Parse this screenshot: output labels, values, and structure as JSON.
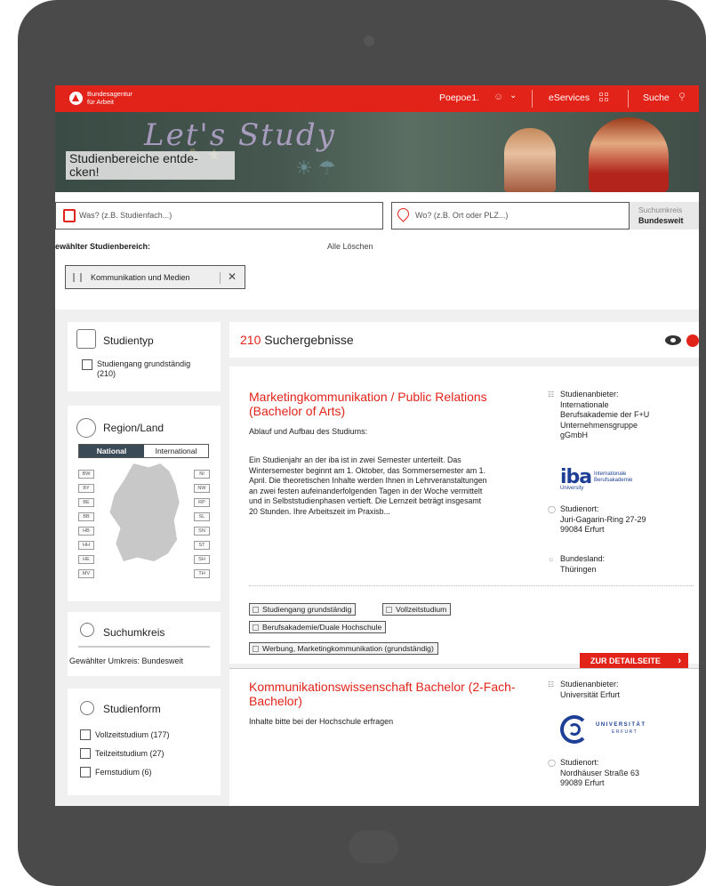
{
  "header": {
    "brand_line1": "Bundesagentur",
    "brand_line2": "für Arbeit",
    "user_name": "Poepoe1.",
    "eservices_label": "eServices",
    "search_label": "Suche"
  },
  "hero": {
    "title_line1": "Studienbereiche entde-",
    "title_line2": "cken!",
    "chalk_text": "Let's Study"
  },
  "search": {
    "what_placeholder": "Was? (z.B. Studienfach...)",
    "where_placeholder": "Wo? (z.B. Ort oder PLZ...)",
    "radius_label": "Suchumkreis",
    "radius_value": "Bundesweit",
    "chosen_label": "ewählter Studienbereich:",
    "clear_all_label": "Alle Löschen",
    "chip_label": "Kommunikation und Medien"
  },
  "filters": {
    "studientyp": {
      "title": "Studientyp",
      "option_line1": "Studiengang grundständig",
      "option_line2": "(210)"
    },
    "region": {
      "title": "Region/Land",
      "toggle_national": "National",
      "toggle_international": "International",
      "states_left": [
        "BW",
        "BY",
        "BE",
        "BB",
        "HB",
        "HH",
        "HE",
        "MV"
      ],
      "states_right": [
        "NI",
        "NW",
        "RP",
        "SL",
        "SN",
        "ST",
        "SH",
        "TH"
      ]
    },
    "suchumkreis": {
      "title": "Suchumkreis",
      "selected_text": "Gewählter Umkreis: Bundesweit"
    },
    "studienform": {
      "title": "Studienform",
      "options": [
        "Vollzeitstudium (177)",
        "Teilzeitstudium (27)",
        "Fernstudium (6)"
      ]
    }
  },
  "results": {
    "count": "210",
    "count_label": "Suchergebnisse",
    "items": [
      {
        "title_line1": "Marketingkommunikation / Public Relations",
        "title_line2": "(Bachelor of Arts)",
        "subtitle": "Ablauf und Aufbau des Studiums:",
        "desc_lines": [
          "Ein Studienjahr an der iba ist in zwei Semester unterteilt. Das",
          "Wintersemester beginnt am 1. Oktober, das Sommersemester am 1.",
          "April. Die theoretischen Inhalte werden Ihnen in Lehrveranstaltungen",
          "an zwei festen aufeinanderfolgenden Tagen in der Woche vermittelt",
          "und in Selbststudienphasen vertieft. Die Lernzeit beträgt insgesamt",
          "20 Stunden. Ihre Arbeitszeit im Praxisb..."
        ],
        "provider_label": "Studienanbieter:",
        "provider_lines": [
          "Internationale",
          "Berufsakademie der F+U",
          "Unternehmensgruppe",
          "gGmbH"
        ],
        "logo_big": "iba",
        "logo_small_line1": "Internationale",
        "logo_small_line2": "Berufsakademie",
        "logo_uni": "University",
        "location_label": "Studienort:",
        "location_lines": [
          "Juri-Gagarin-Ring 27-29",
          "99084 Erfurt"
        ],
        "state_label": "Bundesland:",
        "state_value": "Thüringen",
        "tags": [
          "Studiengang grundständig",
          "Vollzeitstudium",
          "Berufsakademie/Duale Hochschule",
          "Werbung, Marketingkommunikation (grundständig)"
        ],
        "detail_button": "ZUR DETAILSEITE"
      },
      {
        "title_line1": "Kommunikationswissenschaft Bachelor (2-Fach-",
        "title_line2": "Bachelor)",
        "subtitle": "Inhalte bitte bei der Hochschule erfragen",
        "provider_label": "Studienanbieter:",
        "provider_lines": [
          "Universität Erfurt"
        ],
        "logo_line1": "UNIVERSITÄT",
        "logo_line2": "ERFURT",
        "location_label": "Studienort:",
        "location_lines": [
          "Nordhäuser Straße 63",
          "99089 Erfurt"
        ]
      }
    ]
  }
}
